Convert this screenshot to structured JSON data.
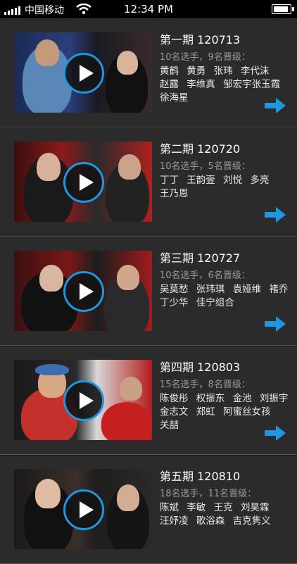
{
  "status": {
    "carrier": "中国移动",
    "time": "12:34 PM"
  },
  "episodes": [
    {
      "title": "第一期 120713",
      "summary": "10名选手，9名晋级：",
      "names": [
        "黄鹤",
        "黄勇",
        "张玮",
        "李代沫",
        "赵露",
        "李维真",
        "邹宏宇张玉霞",
        "徐海星"
      ]
    },
    {
      "title": "第二期 120720",
      "summary": "10名选手，5名晋级：",
      "names": [
        "丁丁",
        "王韵壹",
        "刘悦",
        "多亮",
        "王乃恩"
      ]
    },
    {
      "title": "第三期 120727",
      "summary": "10名选手，6名晋级：",
      "names": [
        "吴莫愁",
        "张玮琪",
        "袁娅维",
        "褚乔",
        "丁少华",
        "佳宁组合"
      ]
    },
    {
      "title": "第四期 120803",
      "summary": "15名选手，8名晋级：",
      "names": [
        "陈俊彤",
        "权振东",
        "金池",
        "刘振宇",
        "金志文",
        "郑虹",
        "阿蜜丝女孩",
        "关喆"
      ]
    },
    {
      "title": "第五期 120810",
      "summary": "18名选手，11名晋级：",
      "names": [
        "陈斌",
        "李敏",
        "王克",
        "刘昊霖",
        "汪妤凌",
        "歌浴森",
        "吉克隽义"
      ]
    }
  ],
  "colors": {
    "accent": "#2196e0",
    "background": "#2b2b2b"
  }
}
